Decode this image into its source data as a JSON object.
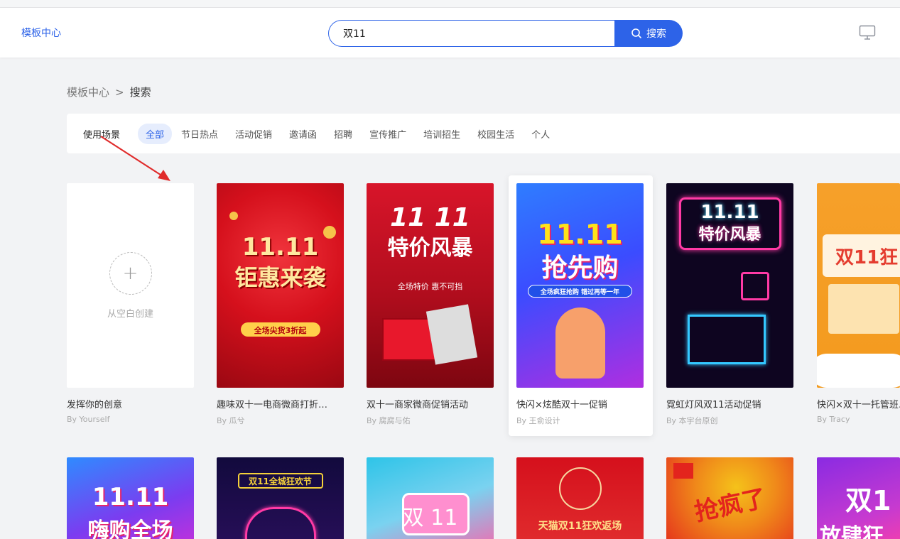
{
  "header": {
    "brand": "模板中心",
    "search_value": "双11",
    "search_button": "搜索"
  },
  "breadcrumb": {
    "root": "模板中心",
    "separator": ">",
    "current": "搜索"
  },
  "filter": {
    "label": "使用场景",
    "chips": [
      "全部",
      "节日热点",
      "活动促销",
      "邀请函",
      "招聘",
      "宣传推广",
      "培训招生",
      "校园生活",
      "个人"
    ],
    "active_index": 0
  },
  "blank_card": {
    "plus": "+",
    "label": "从空白创建",
    "title": "发挥你的创意",
    "author": "By Yourself"
  },
  "templates": [
    {
      "title": "趣味双十一电商微商打折…",
      "author": "By 瓜兮",
      "poster_line1": "11.11",
      "poster_line2": "钜惠来袭",
      "poster_sub": "全场尖货3折起",
      "colors": [
        "#d5101c",
        "#a10a14"
      ]
    },
    {
      "title": "双十一商家微商促销活动",
      "author": "By 腐腐与佑",
      "poster_line1": "11 11",
      "poster_line2": "特价风暴",
      "poster_sub": "全场特价 惠不可挡",
      "colors": [
        "#c8101f",
        "#8e0812"
      ]
    },
    {
      "title": "快闪×炫酷双十一促销",
      "author": "By 王俞设计",
      "poster_line1": "11.11",
      "poster_line2": "抢先购",
      "poster_sub": "全场疯狂抢购 错过再等一年",
      "colors": [
        "#2f5bff",
        "#b02ee0"
      ]
    },
    {
      "title": "霓虹灯风双11活动促销",
      "author": "By 本宇台原创",
      "poster_line1": "11.11",
      "poster_line2": "特价风暴",
      "poster_sub": "",
      "colors": [
        "#0b0420",
        "#1a0638"
      ]
    },
    {
      "title": "快闪×双十一托管班…",
      "author": "By Tracy",
      "poster_line1": "双11狂",
      "poster_line2": "",
      "poster_sub": "",
      "colors": [
        "#f39a1e",
        "#f6b84a"
      ]
    }
  ],
  "row2": [
    {
      "text": "11.11",
      "sub": "嗨购全场",
      "colors": [
        "#2f8bff",
        "#d02ed7"
      ]
    },
    {
      "text": "双11全城狂欢节",
      "sub": "",
      "colors": [
        "#120a3d",
        "#2a0f5c"
      ]
    },
    {
      "text": "双 11",
      "sub": "",
      "colors": [
        "#2ec4e8",
        "#ff5fa8"
      ]
    },
    {
      "text": "天猫双11狂欢返场",
      "sub": "",
      "colors": [
        "#c5101c",
        "#e23030"
      ]
    },
    {
      "text": "抢疯了",
      "sub": "",
      "colors": [
        "#f5c21a",
        "#e3241d"
      ]
    },
    {
      "text": "双1",
      "sub": "放肆狂",
      "colors": [
        "#8a2be2",
        "#ff3fa4"
      ]
    }
  ]
}
